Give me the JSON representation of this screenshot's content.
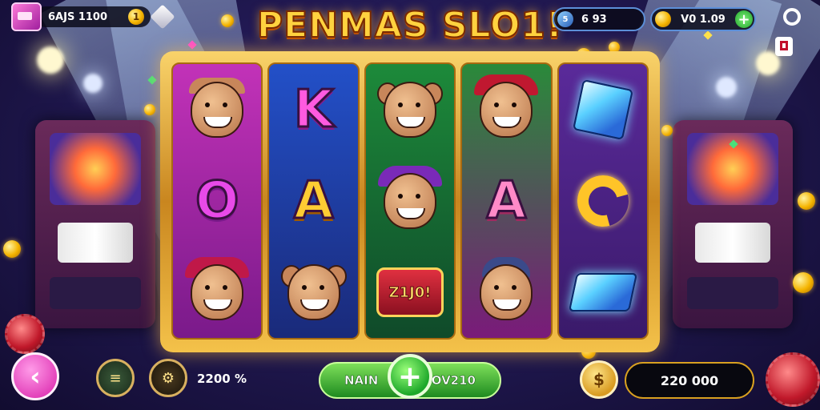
{
  "title": "PENMAS SLO1!",
  "topbar": {
    "balance": "6AJS 1100",
    "balance_coin_glyph": "1",
    "level_badge_glyph": "5",
    "level": "6 93",
    "coins": "V0 1.09",
    "add_glyph": "+"
  },
  "reels": {
    "reel_2_top": "K",
    "reel_1_mid": "O",
    "reel_2_mid": "A",
    "reel_4_mid": "A",
    "reel_3_bottom": "Z1J0!"
  },
  "bottombar": {
    "back_glyph": "‹",
    "bet": "2200 %",
    "spin_left": "NAIN",
    "spin_right": "OV210",
    "spin_glyph": "+",
    "win_total": "220 000"
  },
  "icons": {
    "chest": "treasure-chest-icon",
    "diamond": "diamond-icon",
    "settings": "settings-icon",
    "menu": "menu-icon",
    "back": "back-arrow-icon",
    "paytable": "paytable-icon",
    "autospin": "autospin-icon",
    "coin": "coin-icon"
  },
  "colors": {
    "title": "#ffd23f",
    "frame_gold": "#e0a83a",
    "spin_green": "#1ea82a",
    "back_pink": "#d81fa8"
  }
}
